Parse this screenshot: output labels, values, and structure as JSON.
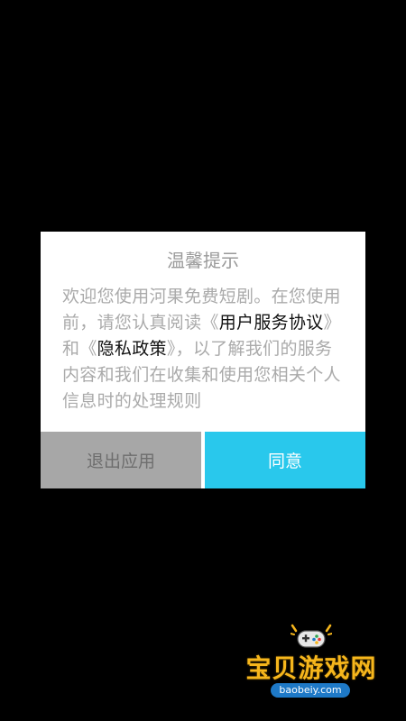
{
  "dialog": {
    "title": "温馨提示",
    "body_prefix": "欢迎您使用河果免费短剧。在您使用前，请您认真阅读",
    "bracket_open_1": "《",
    "link_terms": "用户服务协议",
    "bracket_close_1": "》",
    "body_middle": "和",
    "bracket_open_2": "《",
    "link_privacy": "隐私政策",
    "bracket_close_2": "》",
    "body_suffix": "，以了解我们的服务内容和我们在收集和使用您相关个人信息时的处理规则",
    "exit_label": "退出应用",
    "agree_label": "同意"
  },
  "watermark": {
    "site_name": "宝贝游戏网",
    "url": "baobeiy.com",
    "icon": "gamepad-icon"
  },
  "colors": {
    "background": "#000000",
    "dialog_bg": "#ffffff",
    "exit_button_bg": "#a7a7a7",
    "agree_button_bg": "#29c8ec",
    "watermark_text": "#f6b61c",
    "watermark_url_bg": "#1e79c7"
  }
}
